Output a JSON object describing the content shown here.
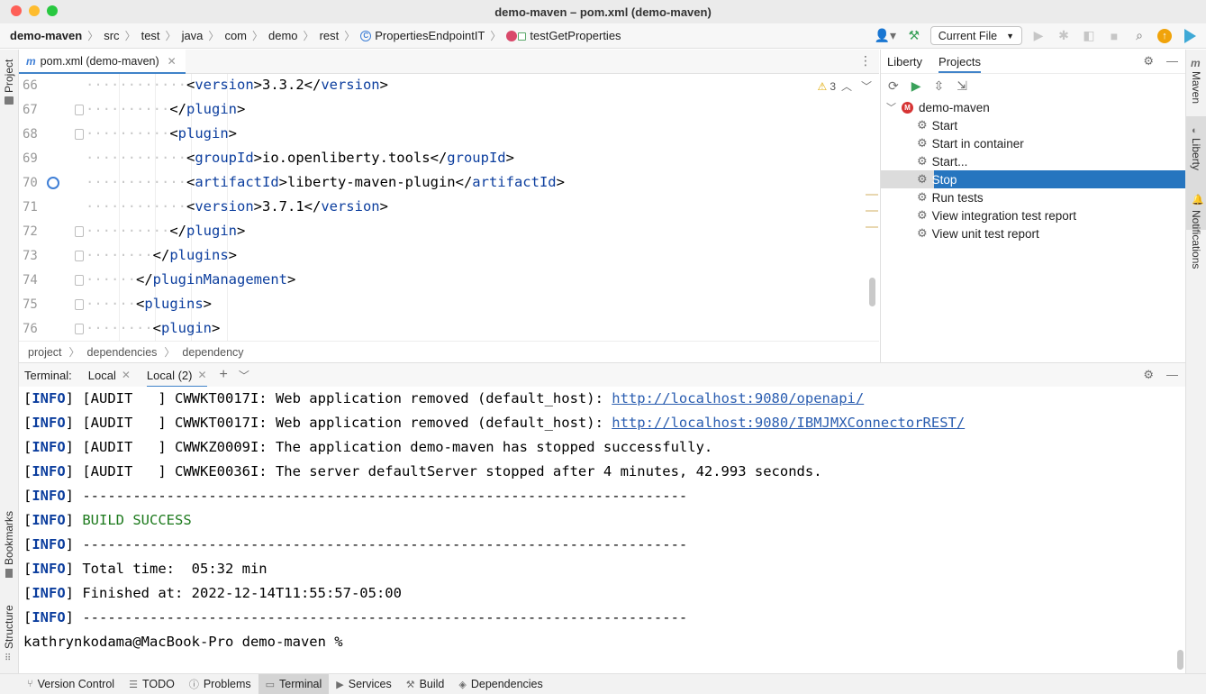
{
  "window": {
    "title": "demo-maven – pom.xml (demo-maven)"
  },
  "nav": {
    "breadcrumbs": [
      "demo-maven",
      "src",
      "test",
      "java",
      "com",
      "demo",
      "rest",
      "PropertiesEndpointIT",
      "testGetProperties"
    ],
    "run_config": "Current File"
  },
  "left_strip": {
    "project": "Project",
    "bookmarks": "Bookmarks",
    "structure": "Structure"
  },
  "right_strip": {
    "maven": "Maven",
    "liberty": "Liberty",
    "notifications": "Notifications"
  },
  "editor": {
    "tab_label": "pom.xml (demo-maven)",
    "warning_count": "3",
    "lines": [
      {
        "num": "66",
        "indent": "············",
        "pre": "<",
        "tag": "version",
        "mid": ">3.3.2</",
        "tag2": "version",
        "post": ">"
      },
      {
        "num": "67",
        "indent": "··········",
        "pre": "</",
        "tag": "plugin",
        "mid": ">",
        "tag2": "",
        "post": ""
      },
      {
        "num": "68",
        "indent": "··········",
        "pre": "<",
        "tag": "plugin",
        "mid": ">",
        "tag2": "",
        "post": ""
      },
      {
        "num": "69",
        "indent": "············",
        "pre": "<",
        "tag": "groupId",
        "mid": ">io.openliberty.tools</",
        "tag2": "groupId",
        "post": ">"
      },
      {
        "num": "70",
        "indent": "············",
        "pre": "<",
        "tag": "artifactId",
        "mid": ">liberty-maven-plugin</",
        "tag2": "artifactId",
        "post": ">"
      },
      {
        "num": "71",
        "indent": "············",
        "pre": "<",
        "tag": "version",
        "mid": ">3.7.1</",
        "tag2": "version",
        "post": ">"
      },
      {
        "num": "72",
        "indent": "··········",
        "pre": "</",
        "tag": "plugin",
        "mid": ">",
        "tag2": "",
        "post": ""
      },
      {
        "num": "73",
        "indent": "········",
        "pre": "</",
        "tag": "plugins",
        "mid": ">",
        "tag2": "",
        "post": ""
      },
      {
        "num": "74",
        "indent": "······",
        "pre": "</",
        "tag": "pluginManagement",
        "mid": ">",
        "tag2": "",
        "post": ""
      },
      {
        "num": "75",
        "indent": "······",
        "pre": "<",
        "tag": "plugins",
        "mid": ">",
        "tag2": "",
        "post": ""
      },
      {
        "num": "76",
        "indent": "········",
        "pre": "<",
        "tag": "plugin",
        "mid": ">",
        "tag2": "",
        "post": ""
      }
    ],
    "xml_breadcrumbs": [
      "project",
      "dependencies",
      "dependency"
    ]
  },
  "liberty": {
    "tabs": [
      "Liberty",
      "Projects"
    ],
    "project": "demo-maven",
    "project_badge": "M",
    "actions": [
      "Start",
      "Start in container",
      "Start...",
      "Stop",
      "Run tests",
      "View integration test report",
      "View unit test report"
    ],
    "selected_action": "Stop"
  },
  "terminal": {
    "label": "Terminal:",
    "tabs": [
      "Local",
      "Local (2)"
    ],
    "lines": [
      {
        "tag": "INFO",
        "text": "[AUDIT   ] CWWKT0017I: Web application removed (default_host): ",
        "link": "http://localhost:9080/openapi/"
      },
      {
        "tag": "INFO",
        "text": "[AUDIT   ] CWWKT0017I: Web application removed (default_host): ",
        "link": "http://localhost:9080/IBMJMXConnectorREST/"
      },
      {
        "tag": "INFO",
        "text": "[AUDIT   ] CWWKZ0009I: The application demo-maven has stopped successfully.",
        "link": ""
      },
      {
        "tag": "INFO",
        "text": "[AUDIT   ] CWWKE0036I: The server defaultServer stopped after 4 minutes, 42.993 seconds.",
        "link": ""
      },
      {
        "tag": "INFO",
        "text": "------------------------------------------------------------------------",
        "link": ""
      },
      {
        "tag": "INFO",
        "text": "BUILD SUCCESS",
        "link": "",
        "success": true
      },
      {
        "tag": "INFO",
        "text": "------------------------------------------------------------------------",
        "link": ""
      },
      {
        "tag": "INFO",
        "text": "Total time:  05:32 min",
        "link": ""
      },
      {
        "tag": "INFO",
        "text": "Finished at: 2022-12-14T11:55:57-05:00",
        "link": ""
      },
      {
        "tag": "INFO",
        "text": "------------------------------------------------------------------------",
        "link": ""
      }
    ],
    "prompt": "kathrynkodama@MacBook-Pro demo-maven %"
  },
  "statusbar": {
    "items": [
      "Version Control",
      "TODO",
      "Problems",
      "Terminal",
      "Services",
      "Build",
      "Dependencies"
    ],
    "active": "Terminal"
  },
  "colors": {
    "accent": "#4083c9",
    "selection": "#2675bf",
    "xml_tag": "#0c3e9e",
    "success": "#1d7a1d",
    "link": "#2a5db0"
  }
}
